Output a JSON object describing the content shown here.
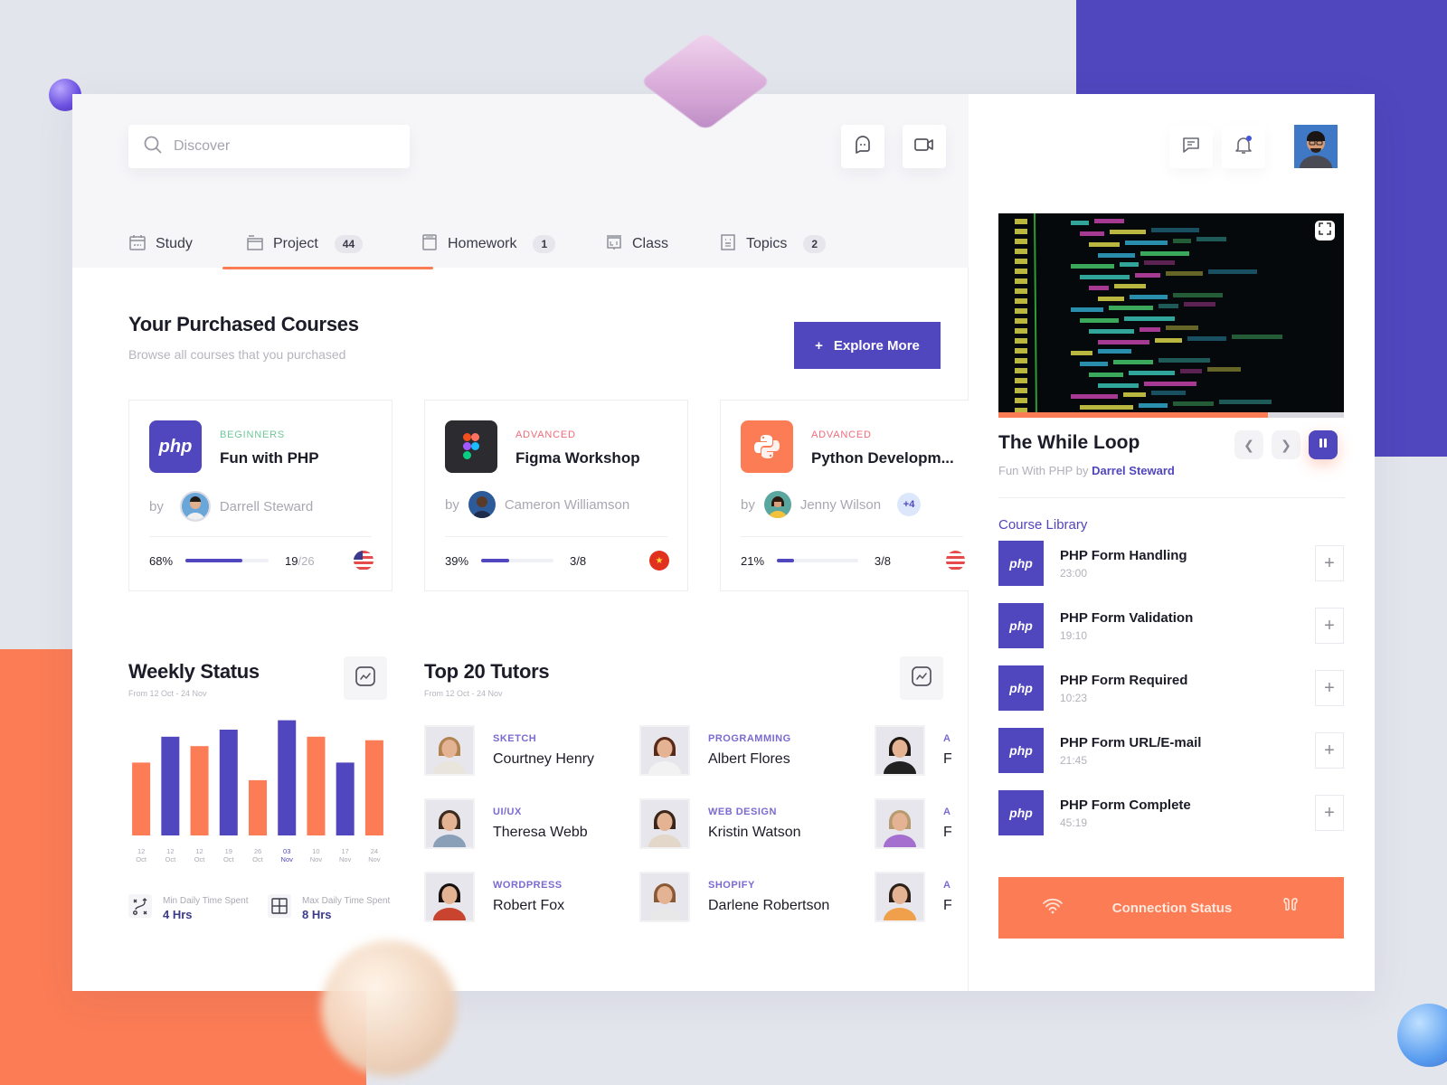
{
  "search": {
    "placeholder": "Discover"
  },
  "tabs": [
    {
      "label": "Study",
      "icon": "calendar-icon",
      "badge": null
    },
    {
      "label": "Project",
      "icon": "folder-icon",
      "badge": "44",
      "active": true
    },
    {
      "label": "Homework",
      "icon": "notebook-icon",
      "badge": "1"
    },
    {
      "label": "Class",
      "icon": "presentation-icon",
      "badge": null
    },
    {
      "label": "Topics",
      "icon": "document-icon",
      "badge": "2"
    }
  ],
  "courses_section": {
    "title": "Your Purchased Courses",
    "subtitle": "Browse all courses that you purchased",
    "explore_label": "Explore More",
    "explore_icon": "+"
  },
  "courses": [
    {
      "level": "BEGINNERS",
      "level_color": "#6fc79a",
      "name": "Fun with PHP",
      "by": "by",
      "author": "Darrell Steward",
      "extra": null,
      "progress_pct": 68,
      "progress_label": "68%",
      "lessons_done": "19",
      "lessons_total": "/26",
      "flag": "us-flag",
      "logo": "php-logo",
      "logo_text": "php",
      "logo_bg": "#5046bd"
    },
    {
      "level": "ADVANCED",
      "level_color": "#f06b7a",
      "name": "Figma Workshop",
      "by": "by",
      "author": "Cameron Williamson",
      "extra": null,
      "progress_pct": 39,
      "progress_label": "39%",
      "lessons_done": "3/8",
      "lessons_total": "",
      "flag": "china-flag",
      "logo": "figma-logo",
      "logo_text": "",
      "logo_bg": "#2b2b30"
    },
    {
      "level": "ADVANCED",
      "level_color": "#f06b7a",
      "name": "Python Developm...",
      "by": "by",
      "author": "Jenny Wilson",
      "extra": "+4",
      "progress_pct": 21,
      "progress_label": "21%",
      "lessons_done": "3/8",
      "lessons_total": "",
      "flag": "us-flag",
      "logo": "python-logo",
      "logo_text": "",
      "logo_bg": "#fb7c55"
    }
  ],
  "weekly": {
    "title": "Weekly Status",
    "subtitle": "From 12 Oct - 24 Nov",
    "min_label": "Min Daily Time Spent",
    "min_value": "4 Hrs",
    "max_label": "Max Daily Time Spent",
    "max_value": "8 Hrs"
  },
  "chart_data": {
    "type": "bar",
    "title": "Weekly Status",
    "subtitle": "From 12 Oct - 24 Nov",
    "categories": [
      "12 Oct",
      "12 Oct",
      "12 Oct",
      "19 Oct",
      "26 Oct",
      "03 Nov",
      "10 Nov",
      "17 Nov",
      "24 Nov"
    ],
    "category_top": [
      "12",
      "12",
      "12",
      "19",
      "26",
      "03",
      "10",
      "17",
      "24"
    ],
    "category_bottom": [
      "Oct",
      "Oct",
      "Oct",
      "Oct",
      "Oct",
      "Nov",
      "Nov",
      "Nov",
      "Nov"
    ],
    "values": [
      62,
      84,
      76,
      90,
      47,
      98,
      84,
      62,
      81
    ],
    "colors": [
      "#fb7c55",
      "#5046bd",
      "#fb7c55",
      "#5046bd",
      "#fb7c55",
      "#5046bd",
      "#fb7c55",
      "#5046bd",
      "#fb7c55"
    ],
    "highlight_index": 5,
    "ylim": [
      0,
      100
    ],
    "grid": false,
    "xlabel": "",
    "ylabel": ""
  },
  "tutors_section": {
    "title": "Top 20 Tutors",
    "subtitle": "From 12 Oct - 24 Nov"
  },
  "tutors": [
    {
      "category": "SKETCH",
      "name": "Courtney Henry",
      "hair": "#b08350",
      "shirt": "#e9e4dc"
    },
    {
      "category": "PROGRAMMING",
      "name": "Albert Flores",
      "hair": "#5a2a18",
      "shirt": "#f2f2f2"
    },
    {
      "category": "A",
      "name": "F",
      "hair": "#1f1712",
      "shirt": "#222"
    },
    {
      "category": "UI/UX",
      "name": "Theresa Webb",
      "hair": "#3b2a1e",
      "shirt": "#8aa0b8"
    },
    {
      "category": "WEB DESIGN",
      "name": "Kristin Watson",
      "hair": "#3a2618",
      "shirt": "#e2d7c8"
    },
    {
      "category": "A",
      "name": "F",
      "hair": "#b89a70",
      "shirt": "#a56fd0"
    },
    {
      "category": "WORDPRESS",
      "name": "Robert Fox",
      "hair": "#171210",
      "shirt": "#c8442f"
    },
    {
      "category": "SHOPIFY",
      "name": "Darlene Robertson",
      "hair": "#8a5a36",
      "shirt": "#e8e8e8"
    },
    {
      "category": "A",
      "name": "F",
      "hair": "#2c2018",
      "shirt": "#f0a04b"
    }
  ],
  "side": {
    "video_title": "The While Loop",
    "video_course": "Fun With PHP by",
    "video_author": "Darrel Steward",
    "video_progress_pct": 78,
    "library_title": "Course Library",
    "library": [
      {
        "name": "PHP Form Handling",
        "duration": "23:00",
        "thumb": "php"
      },
      {
        "name": "PHP Form Validation",
        "duration": "19:10",
        "thumb": "php"
      },
      {
        "name": "PHP Form Required",
        "duration": "10:23",
        "thumb": "php"
      },
      {
        "name": "PHP Form URL/E-mail",
        "duration": "21:45",
        "thumb": "php"
      },
      {
        "name": "PHP Form Complete",
        "duration": "45:19",
        "thumb": "php"
      }
    ],
    "add_symbol": "+",
    "connection_label": "Connection Status"
  },
  "colors": {
    "primary": "#5046bd",
    "accent": "#fb7c55",
    "text": "#1c1c28",
    "muted": "#b5b5be"
  }
}
